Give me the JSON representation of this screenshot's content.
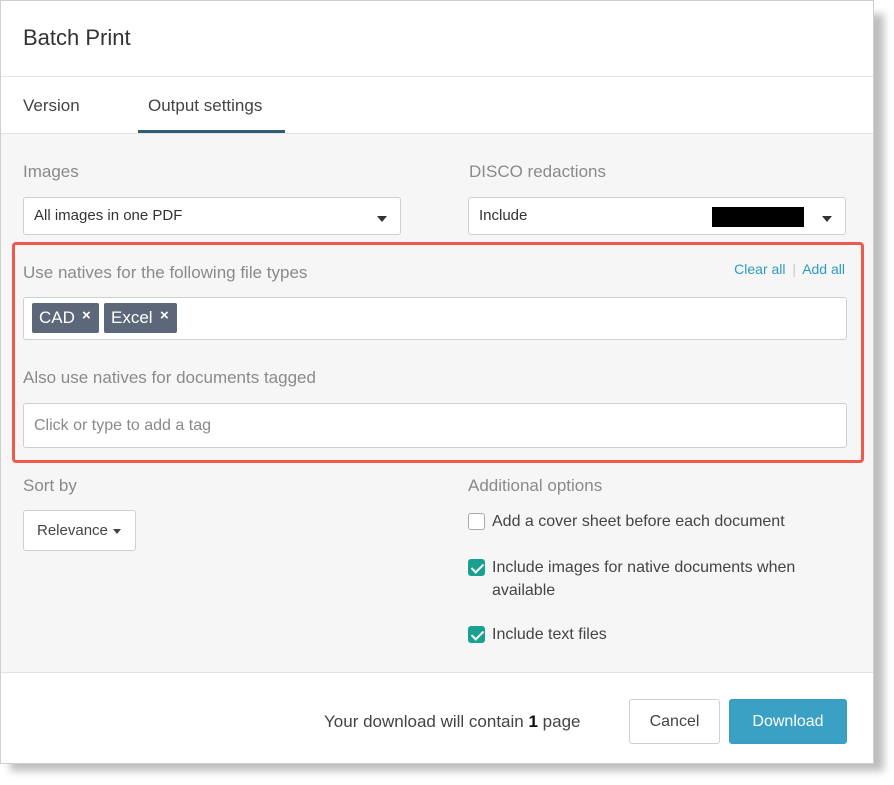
{
  "dialog": {
    "title": "Batch Print"
  },
  "tabs": [
    {
      "label": "Version",
      "active": false
    },
    {
      "label": "Output settings",
      "active": true
    }
  ],
  "images": {
    "label": "Images",
    "selected": "All images in one PDF"
  },
  "disco": {
    "label": "DISCO redactions",
    "selected": "Include"
  },
  "natives": {
    "label": "Use natives for the following file types",
    "clear_all": "Clear all",
    "separator": "|",
    "add_all": "Add all",
    "chips": [
      "CAD",
      "Excel"
    ],
    "chip_remove_glyph": "×"
  },
  "tagged": {
    "label": "Also use natives for documents tagged",
    "placeholder": "Click or type to add a tag",
    "value": ""
  },
  "sort": {
    "label": "Sort by",
    "selected": "Relevance"
  },
  "additional": {
    "label": "Additional options",
    "options": [
      {
        "label": "Add a cover sheet before each document",
        "checked": false
      },
      {
        "label": "Include images for native documents when available",
        "checked": true
      },
      {
        "label": "Include text files",
        "checked": true
      }
    ]
  },
  "footer": {
    "summary_prefix": "Your download will contain",
    "page_count": "1",
    "summary_suffix": "page",
    "cancel": "Cancel",
    "download": "Download"
  },
  "colors": {
    "accent": "#3aa0c4",
    "checkbox": "#19a08f",
    "chip": "#5d677a",
    "highlight": "#ee5a4f",
    "tab_underline": "#2f5c73"
  },
  "icons": {
    "dropdown": "caret-down-icon",
    "checkbox": "checkmark-icon",
    "chip_remove": "close-icon"
  }
}
